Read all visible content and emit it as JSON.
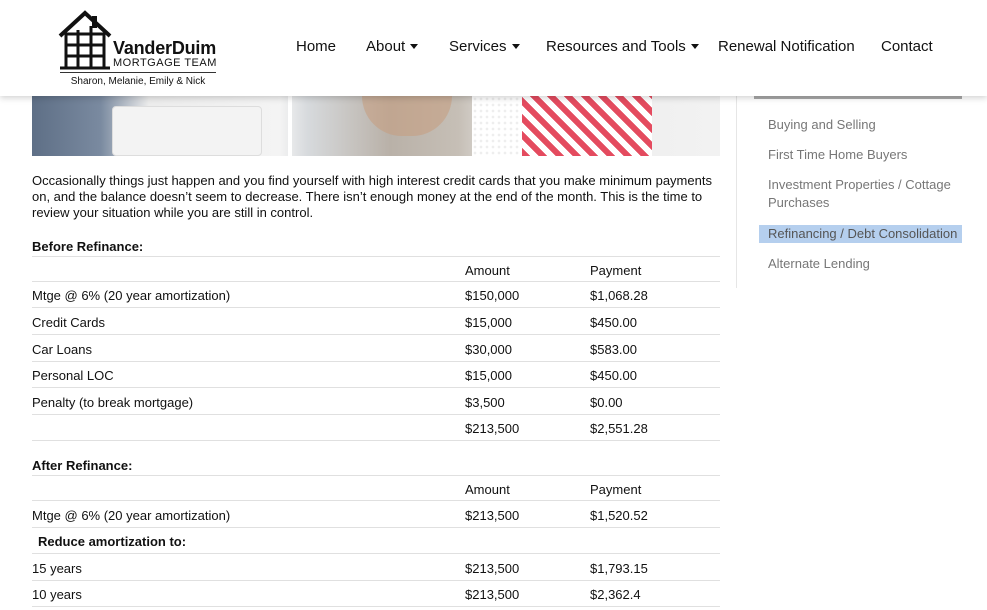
{
  "brand": {
    "name": "VanderDuim",
    "subtitle": "MORTGAGE TEAM",
    "team": "Sharon, Melanie, Emily & Nick"
  },
  "nav": {
    "home": "Home",
    "about": "About",
    "services": "Services",
    "resources": "Resources and Tools",
    "renewal": "Renewal Notification",
    "contact": "Contact"
  },
  "intro": "Occasionally things just happen and you find yourself with high interest credit cards that you make minimum payments on, and the balance doesn’t seem to decrease. There isn’t enough money at the end of the month. This is the time to review your situation while you are still in control.",
  "before": {
    "title": "Before Refinance:",
    "headers": {
      "amount": "Amount",
      "payment": "Payment"
    },
    "rows": [
      {
        "label": "Mtge @ 6% (20 year amortization)",
        "amount": "$150,000",
        "payment": "$1,068.28"
      },
      {
        "label": "Credit Cards",
        "amount": "$15,000",
        "payment": "$450.00"
      },
      {
        "label": "Car Loans",
        "amount": "$30,000",
        "payment": "$583.00"
      },
      {
        "label": "Personal LOC",
        "amount": "$15,000",
        "payment": "$450.00"
      },
      {
        "label": "Penalty (to break mortgage)",
        "amount": "$3,500",
        "payment": "$0.00"
      },
      {
        "label": "",
        "amount": "$213,500",
        "payment": "$2,551.28"
      }
    ]
  },
  "after": {
    "title": "After Refinance:",
    "headers": {
      "amount": "Amount",
      "payment": "Payment"
    },
    "mortgage": {
      "label": "Mtge @ 6% (20 year amortization)",
      "amount": "$213,500",
      "payment": "$1,520.52"
    },
    "reduce_label": "Reduce amortization to:",
    "rows": [
      {
        "label": "15 years",
        "amount": "$213,500",
        "payment": "$1,793.15"
      },
      {
        "label": "10 years",
        "amount": "$213,500",
        "payment": "$2,362.4"
      }
    ]
  },
  "sidebar": {
    "items": [
      {
        "label": "Buying and Selling"
      },
      {
        "label": "First Time Home Buyers"
      },
      {
        "label": "Investment Properties / Cottage Purchases"
      },
      {
        "label": "Refinancing / Debt Consolidation"
      },
      {
        "label": "Alternate Lending"
      }
    ],
    "active_index": 3,
    "active_color": "#b5cfee"
  }
}
